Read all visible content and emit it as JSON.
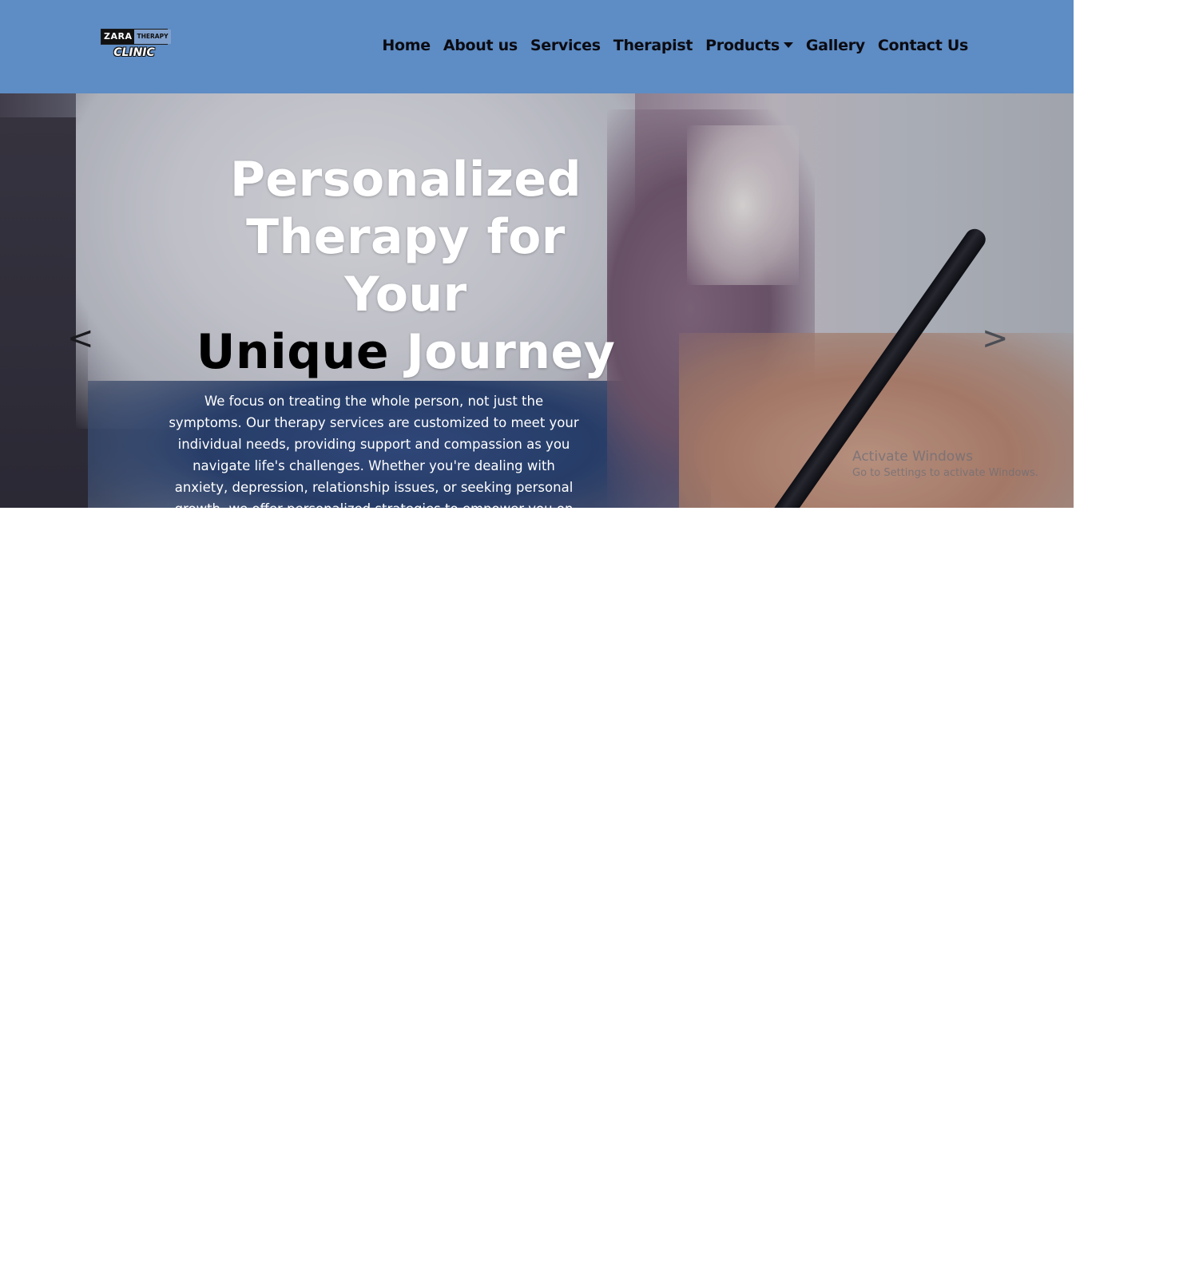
{
  "brand": {
    "logo_top_left": "ZARA",
    "logo_top_right": "THERAPY",
    "logo_bottom": "CLINIC"
  },
  "nav": {
    "items": [
      {
        "label": "Home"
      },
      {
        "label": "About us"
      },
      {
        "label": "Services"
      },
      {
        "label": "Therapist"
      },
      {
        "label": "Products"
      },
      {
        "label": "Gallery"
      },
      {
        "label": "Contact Us"
      }
    ]
  },
  "hero": {
    "title_line1": "Personalized",
    "title_line2": "Therapy for Your",
    "title_dark_word": "Unique",
    "title_last_word": "Journey",
    "description": "We focus on treating the whole person, not just the symptoms. Our therapy services are customized to meet your individual needs, providing support and compassion as you navigate life's challenges. Whether you're dealing with anxiety, depression, relationship issues, or seeking personal growth, we offer personalized strategies to empower you on your path to healing.",
    "prev_label": "<",
    "next_label": ">"
  },
  "watermark": {
    "title": "Activate Windows",
    "subtitle": "Go to Settings to activate Windows."
  },
  "colors": {
    "navbar": "#5e8cc4",
    "nav_text": "#0b0b12",
    "hero_text": "#ffffff",
    "hero_dark_word": "#000000"
  }
}
